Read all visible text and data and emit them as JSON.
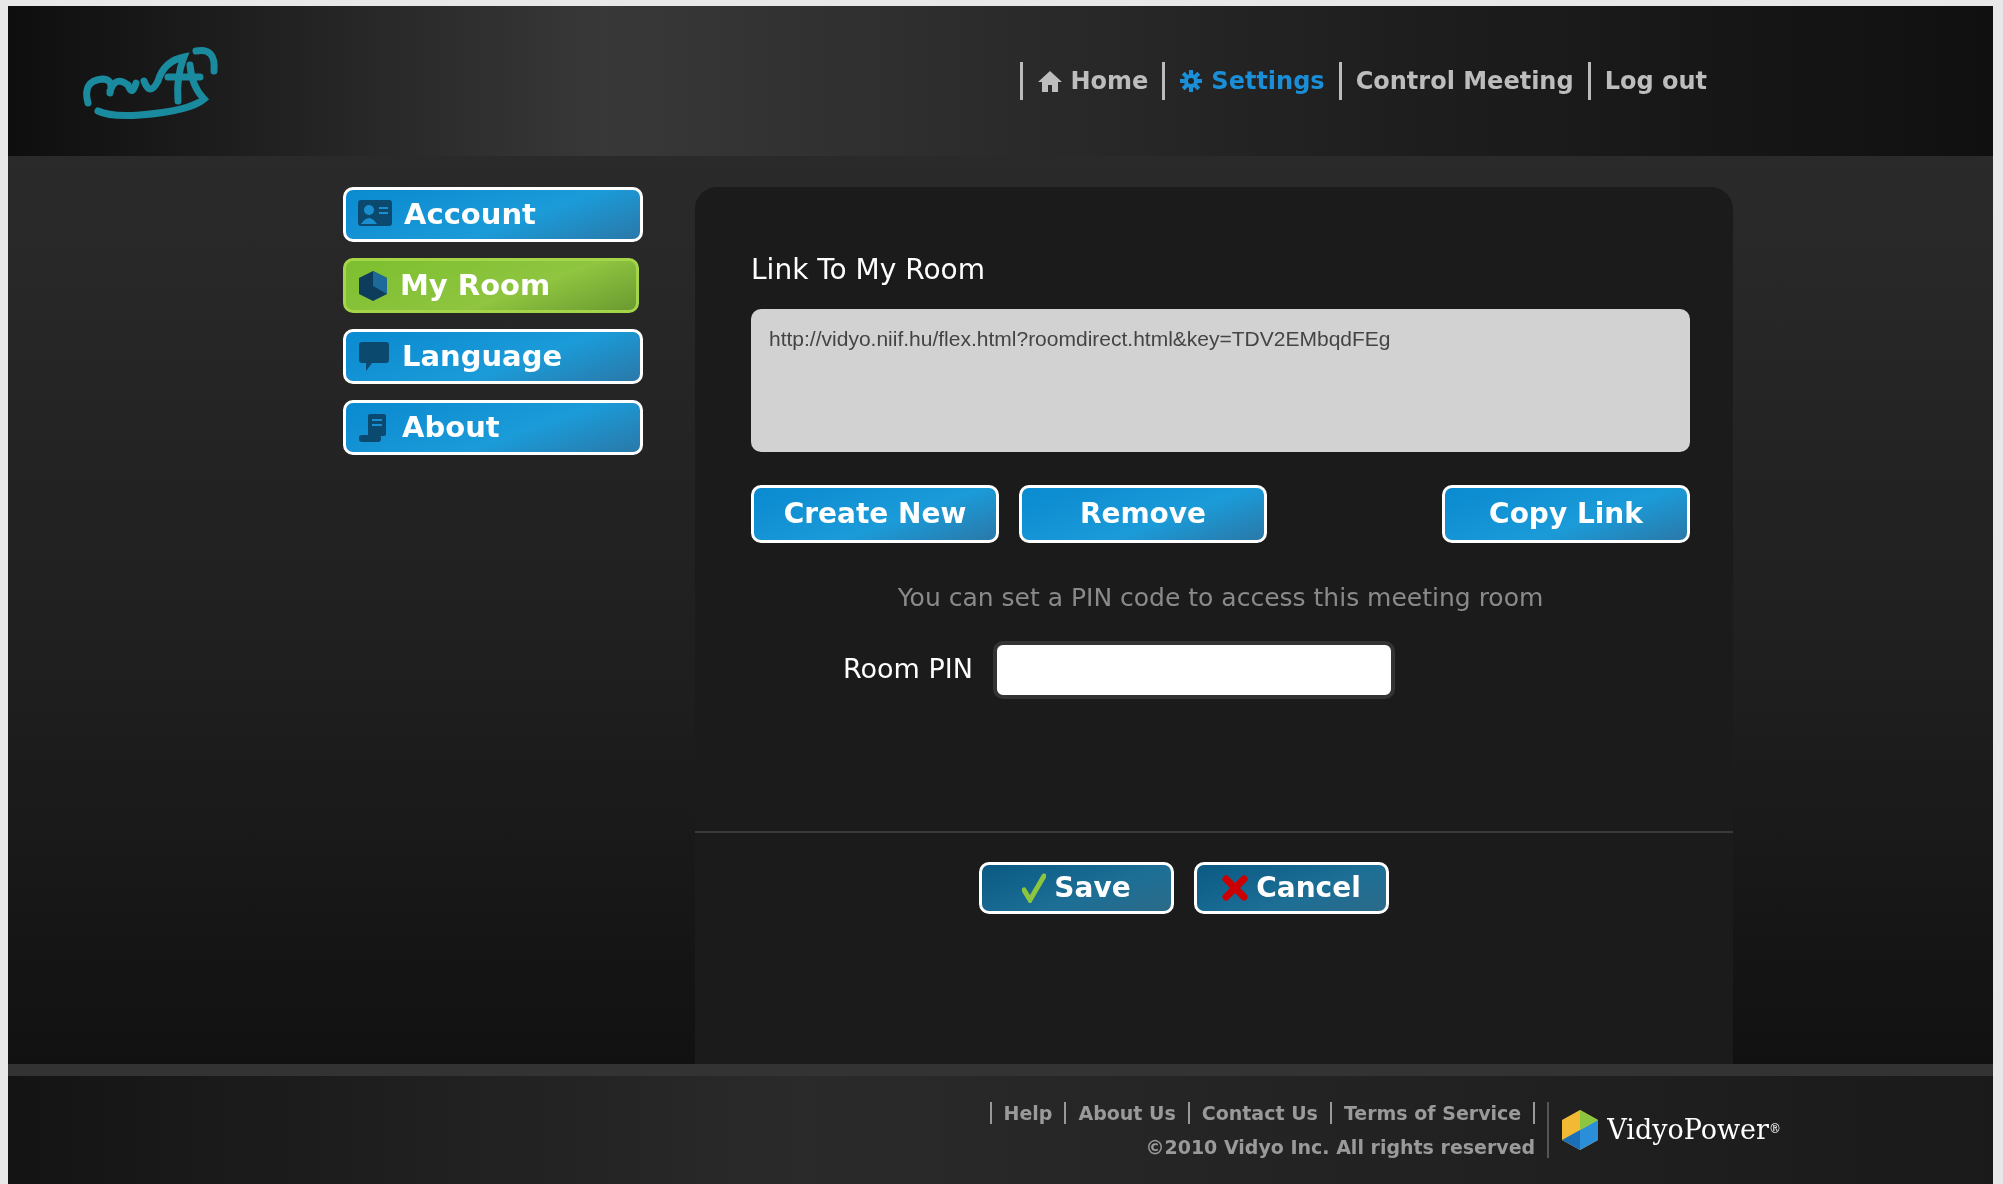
{
  "nav": [
    {
      "label": "Home",
      "selected": false
    },
    {
      "label": "Settings",
      "selected": true
    },
    {
      "label": "Control Meeting",
      "selected": false
    },
    {
      "label": "Log out",
      "selected": false
    }
  ],
  "sidebar": {
    "items": [
      {
        "label": "Account",
        "selected": false
      },
      {
        "label": "My Room",
        "selected": true
      },
      {
        "label": "Language",
        "selected": false
      },
      {
        "label": "About",
        "selected": false
      }
    ]
  },
  "panel": {
    "title": "Link To My Room",
    "link_value": "http://vidyo.niif.hu/flex.html?roomdirect.html&key=TDV2EMbqdFEg",
    "link_buttons": [
      "Create New",
      "Remove",
      "Copy Link"
    ],
    "hint": "You can set a PIN code to access this meeting room",
    "pin": {
      "label": "Room PIN"
    },
    "actions": [
      {
        "label": "Save",
        "kind": "save"
      },
      {
        "label": "Cancel",
        "kind": "cancel"
      }
    ]
  },
  "footer": {
    "links": [
      "Help",
      "About Us",
      "Contact Us",
      "Terms of Service"
    ],
    "copyright": "©2010 Vidyo Inc. All rights reserved",
    "brand": "VidyoPower",
    "brand_mark": "®"
  }
}
